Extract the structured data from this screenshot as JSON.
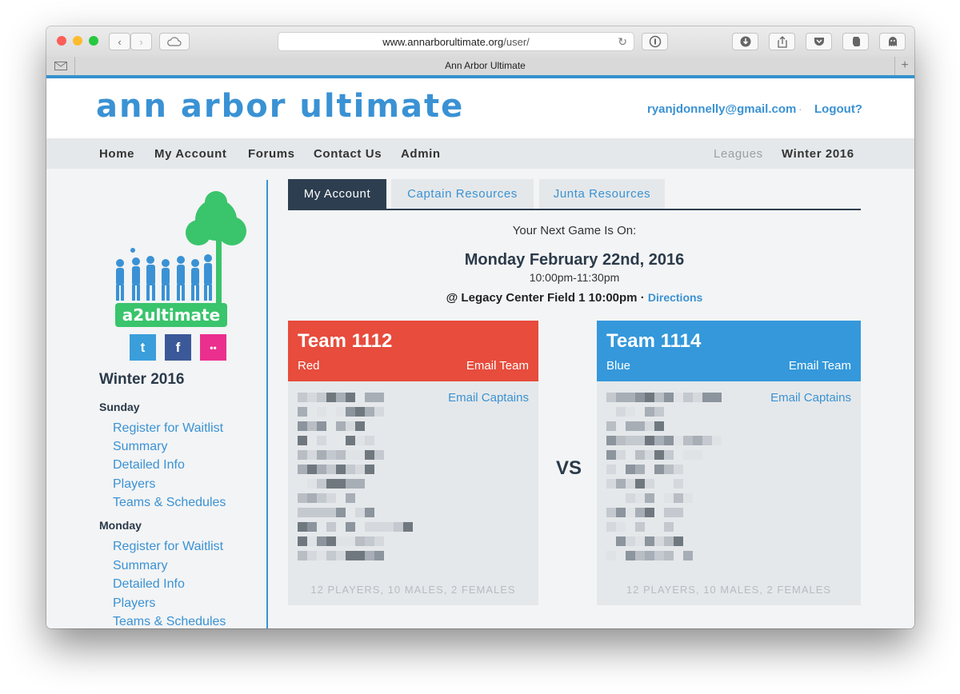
{
  "browser": {
    "url_domain": "www.annarborultimate.org",
    "url_path": "/user/",
    "tab_title": "Ann Arbor Ultimate"
  },
  "header": {
    "site_title": "ann arbor ultimate",
    "user_email": "ryanjdonnelly@gmail.com",
    "separator": "·",
    "logout_label": "Logout?"
  },
  "nav": {
    "items": [
      "Home",
      "My Account",
      "Forums",
      "Contact Us",
      "Admin"
    ],
    "leagues_label": "Leagues",
    "season_label": "Winter 2016"
  },
  "sidebar": {
    "logo_text": "a2ultimate",
    "social": {
      "twitter": "t",
      "facebook": "f",
      "flickr": "••"
    },
    "season": "Winter 2016",
    "days": [
      {
        "day": "Sunday",
        "links": [
          "Register for Waitlist",
          "Summary",
          "Detailed Info",
          "Players",
          "Teams & Schedules"
        ]
      },
      {
        "day": "Monday",
        "links": [
          "Register for Waitlist",
          "Summary",
          "Detailed Info",
          "Players",
          "Teams & Schedules"
        ]
      }
    ]
  },
  "tabs": [
    "My Account",
    "Captain Resources",
    "Junta Resources"
  ],
  "next_game": {
    "label": "Your Next Game Is On:",
    "date": "Monday February 22nd, 2016",
    "time": "10:00pm-11:30pm",
    "location": "@ Legacy Center Field 1 10:00pm",
    "location_sep": " · ",
    "directions_label": "Directions"
  },
  "teams": [
    {
      "name": "Team 1112",
      "color": "Red",
      "email_team": "Email Team",
      "email_captains": "Email Captains",
      "summary": "12 PLAYERS, 10 MALES, 2 FEMALES",
      "accent": "#e74c3c"
    },
    {
      "name": "Team 1114",
      "color": "Blue",
      "email_team": "Email Team",
      "email_captains": "Email Captains",
      "summary": "12 PLAYERS, 10 MALES, 2 FEMALES",
      "accent": "#3498db"
    }
  ],
  "vs_label": "VS",
  "colors": {
    "brand_blue": "#3a92d4",
    "navy": "#2d3e50",
    "red": "#e74c3c",
    "blue": "#3498db",
    "green": "#3ac46c"
  }
}
